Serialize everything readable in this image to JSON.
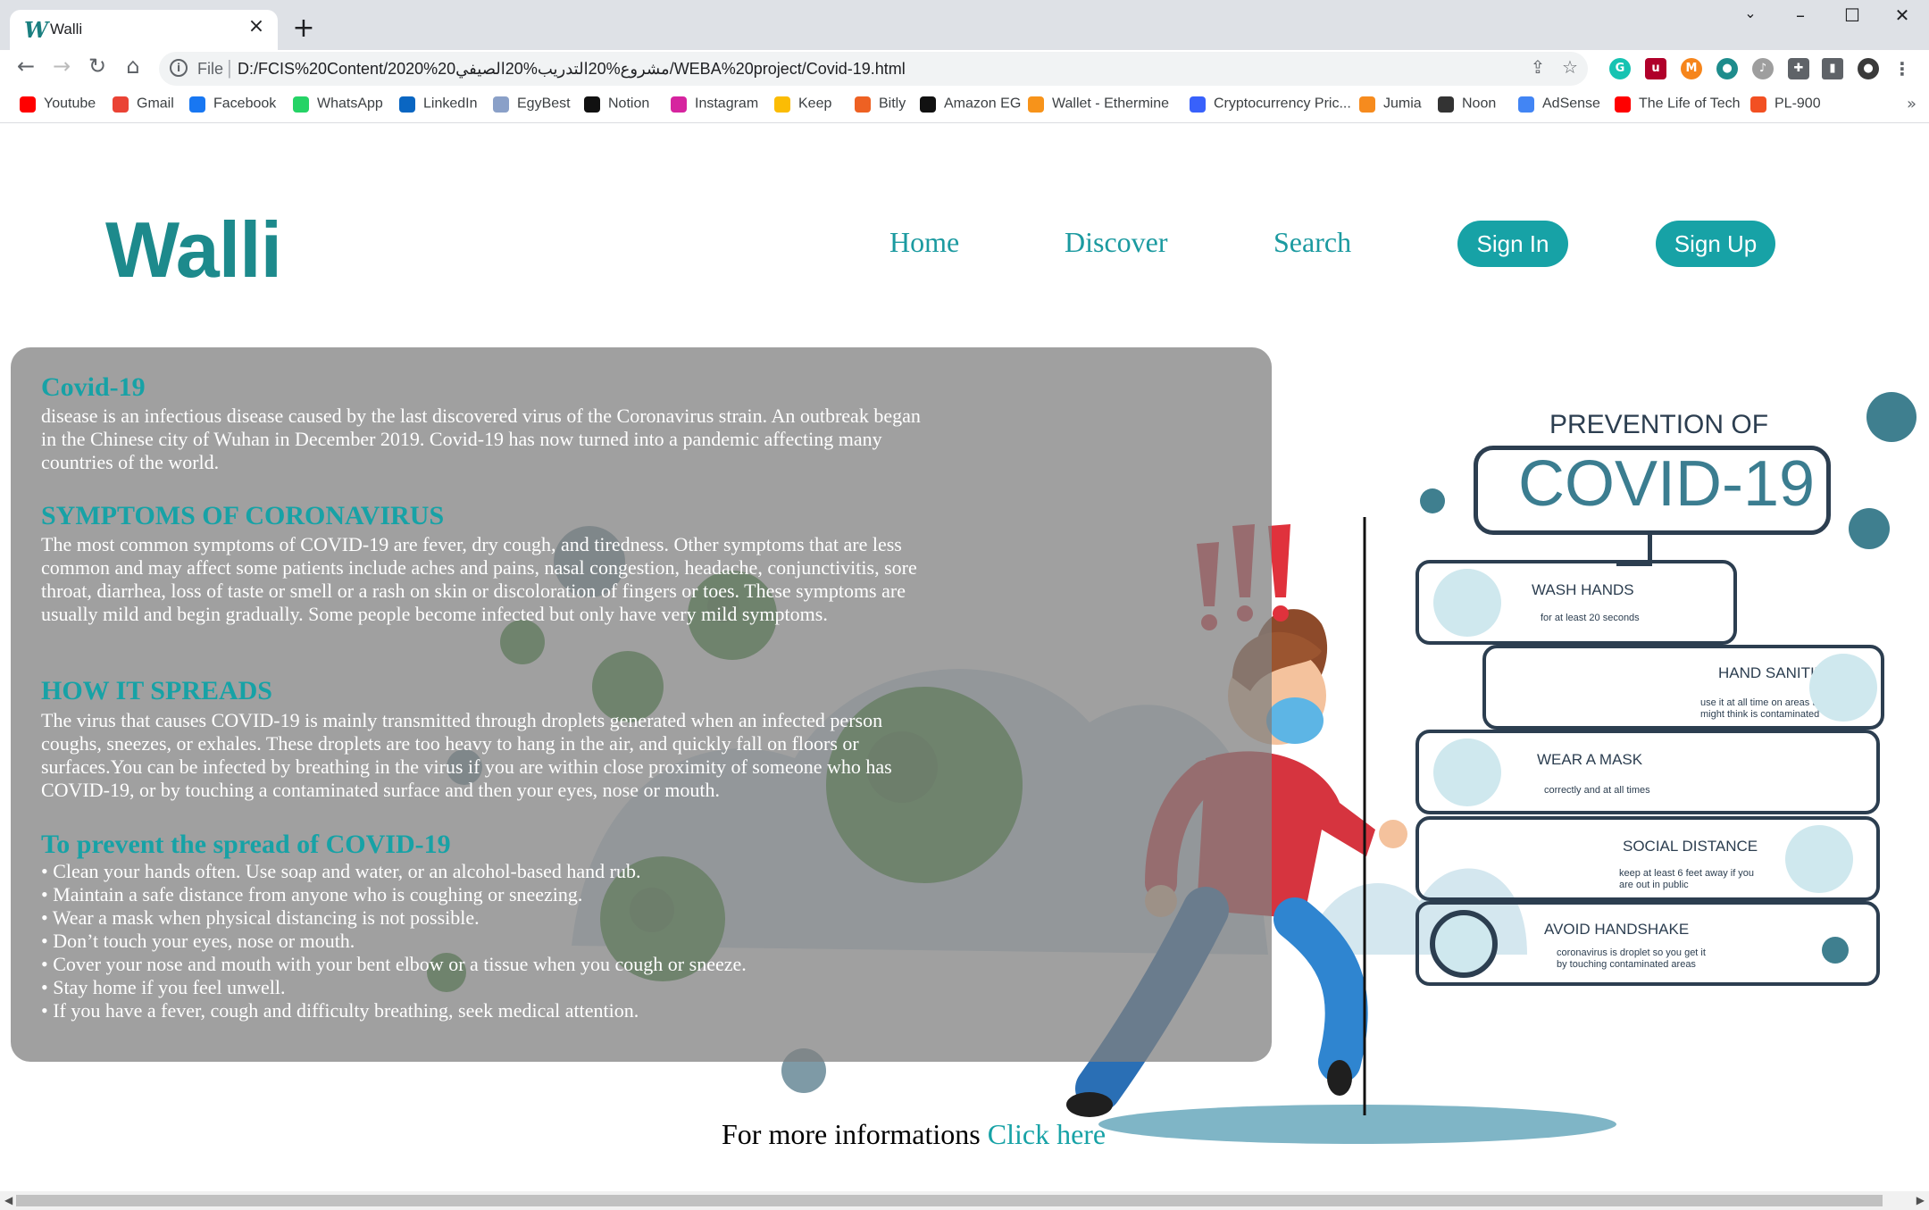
{
  "browser": {
    "tab_title": "Walli",
    "tab_favicon": "W",
    "url_scheme": "File",
    "url": "D:/FCIS%20Content/2020%20مشروع%20التدريب%20الصيفي/WEBA%20project/Covid-19.html",
    "bookmarks": [
      {
        "label": "Youtube",
        "icon": "youtube-icon",
        "color": "#ff0000"
      },
      {
        "label": "Gmail",
        "icon": "gmail-icon",
        "color": "#ea4335"
      },
      {
        "label": "Facebook",
        "icon": "facebook-icon",
        "color": "#1877f2"
      },
      {
        "label": "WhatsApp",
        "icon": "whatsapp-icon",
        "color": "#25d366"
      },
      {
        "label": "LinkedIn",
        "icon": "linkedin-icon",
        "color": "#0a66c2"
      },
      {
        "label": "EgyBest",
        "icon": "egybest-icon",
        "color": "#8aa0c8"
      },
      {
        "label": "Notion",
        "icon": "notion-icon",
        "color": "#111111"
      },
      {
        "label": "Instagram",
        "icon": "instagram-icon",
        "color": "#d6249f"
      },
      {
        "label": "Keep",
        "icon": "keep-icon",
        "color": "#fbbc04"
      },
      {
        "label": "Bitly",
        "icon": "bitly-icon",
        "color": "#ee6123"
      },
      {
        "label": "Amazon EG",
        "icon": "amazon-icon",
        "color": "#111111"
      },
      {
        "label": "Wallet - Ethermine",
        "icon": "ethermine-icon",
        "color": "#f7931a"
      },
      {
        "label": "Cryptocurrency Pric...",
        "icon": "coinmarketcap-icon",
        "color": "#3861fb"
      },
      {
        "label": "Jumia",
        "icon": "jumia-icon",
        "color": "#f68b1e"
      },
      {
        "label": "Noon",
        "icon": "noon-icon",
        "color": "#333333"
      },
      {
        "label": "AdSense",
        "icon": "adsense-icon",
        "color": "#4285f4"
      },
      {
        "label": "The Life of Tech",
        "icon": "youtube-icon",
        "color": "#ff0000"
      },
      {
        "label": "PL-900",
        "icon": "microsoft-icon",
        "color": "#f25022"
      }
    ]
  },
  "site": {
    "logo": "Walli",
    "nav": {
      "home": "Home",
      "discover": "Discover",
      "search": "Search",
      "sign_in": "Sign In",
      "sign_up": "Sign Up"
    },
    "colors": {
      "accent": "#17a2a6",
      "logo": "#1d8a8c"
    }
  },
  "content": {
    "covid_title": "Covid-19",
    "covid_text": "disease is an infectious disease caused by the last discovered virus of the Coronavirus strain. An outbreak began in the Chinese city of Wuhan in December 2019. Covid-19 has now turned into a pandemic affecting many countries of the world.",
    "symptoms_title": "SYMPTOMS OF CORONAVIRUS",
    "symptoms_text": "The most common symptoms of COVID-19 are fever, dry cough, and tiredness. Other symptoms that are less common and may affect some patients include aches and pains, nasal congestion, headache, conjunctivitis, sore throat, diarrhea, loss of taste or smell or a rash on skin or discoloration of fingers or toes. These symptoms are usually mild and begin gradually. Some people become infected but only have very mild symptoms.",
    "spread_title": "HOW IT SPREADS",
    "spread_text": "The virus that causes COVID-19 is mainly transmitted through droplets generated when an infected person coughs, sneezes, or exhales. These droplets are too heavy to hang in the air, and quickly fall on floors or surfaces.You can be infected by breathing in the virus if you are within close proximity of someone who has COVID-19, or by touching a contaminated surface and then your eyes, nose or mouth.",
    "prevent_title": "To prevent the spread of COVID-19",
    "prevent_items": [
      "• Clean your hands often. Use soap and water, or an alcohol-based hand rub.",
      "• Maintain a safe distance from anyone who is coughing or sneezing.",
      "• Wear a mask when physical distancing is not possible.",
      "• Don’t touch your eyes, nose or mouth.",
      "• Cover your nose and mouth with your bent elbow or a tissue when you cough or sneeze.",
      "• Stay home if you feel unwell.",
      "• If you have a fever, cough and difficulty breathing, seek medical attention."
    ]
  },
  "infographic": {
    "title_top": "PREVENTION OF",
    "title_main": "COVID-19",
    "items": [
      {
        "name": "WASH HANDS",
        "sub": "for at least 20 seconds"
      },
      {
        "name": "HAND SANITIZER",
        "sub": "use it at all time on areas that you might think is contaminated"
      },
      {
        "name": "WEAR A MASK",
        "sub": "correctly and at all times"
      },
      {
        "name": "SOCIAL DISTANCE",
        "sub": "keep at least 6 feet away if you are out in public"
      },
      {
        "name": "AVOID HANDSHAKE",
        "sub": "coronavirus is droplet so you get it by touching contaminated areas"
      }
    ]
  },
  "footer": {
    "text": "For more informations ",
    "link": "Click here"
  }
}
